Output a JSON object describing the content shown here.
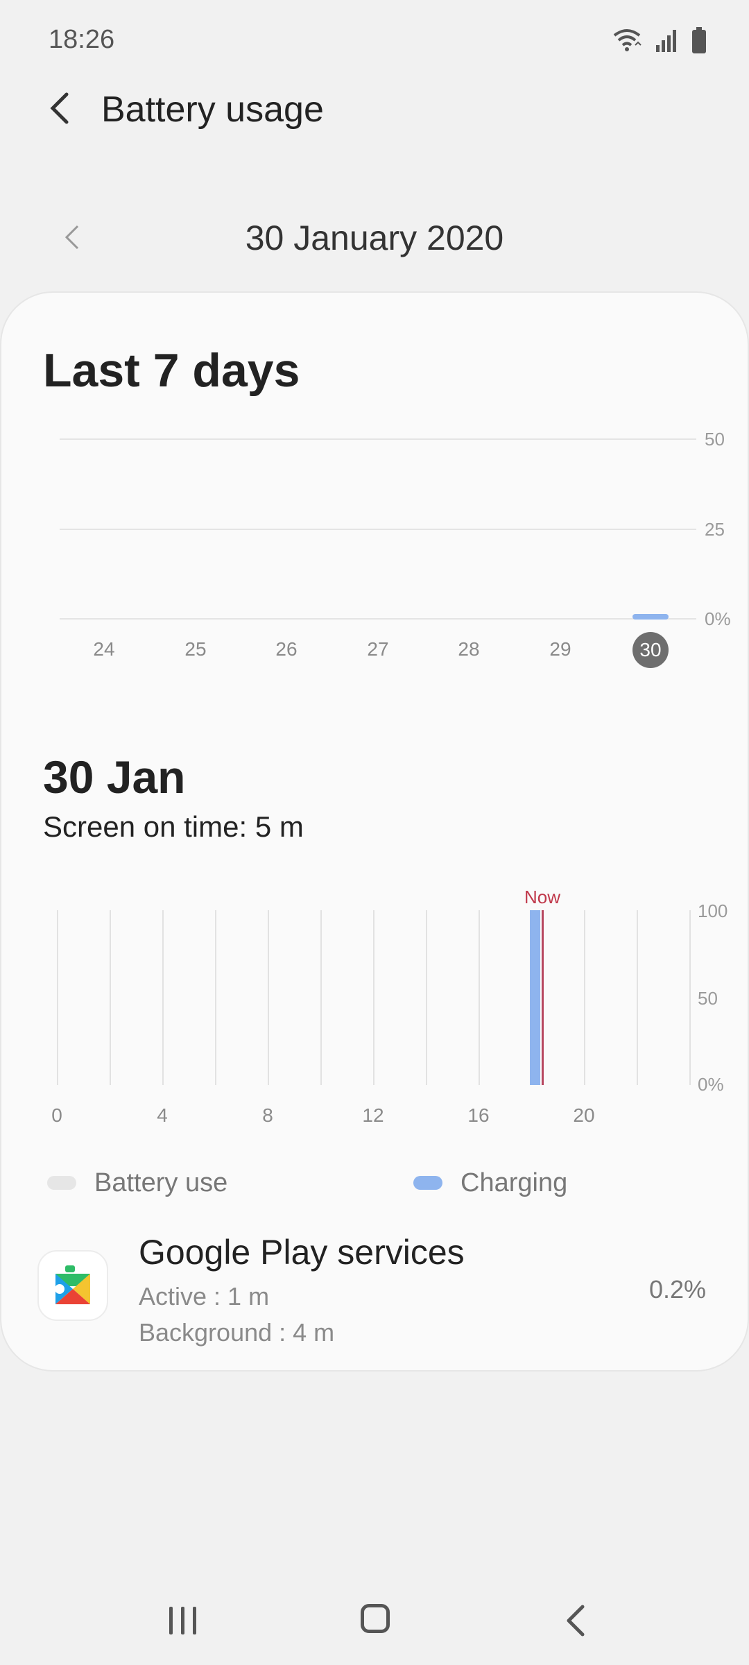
{
  "status_bar": {
    "time": "18:26"
  },
  "header": {
    "title": "Battery usage"
  },
  "date_selector": {
    "label": "30 January 2020"
  },
  "weekly": {
    "title": "Last 7 days",
    "y_labels": [
      "50",
      "25",
      "0%"
    ],
    "days": [
      "24",
      "25",
      "26",
      "27",
      "28",
      "29",
      "30"
    ],
    "selected_day": "30"
  },
  "daily": {
    "title": "30 Jan",
    "screen_on_time": "Screen on time: 5 m",
    "now_label": "Now",
    "y_labels": [
      "100",
      "50",
      "0%"
    ],
    "x_labels": [
      "0",
      "4",
      "8",
      "12",
      "16",
      "20"
    ]
  },
  "legend": {
    "battery_use": "Battery use",
    "charging": "Charging"
  },
  "apps": [
    {
      "name": "Google Play services",
      "active": "Active : 1 m",
      "background": "Background : 4 m",
      "percent": "0.2%"
    }
  ],
  "chart_data": [
    {
      "type": "bar",
      "title": "Last 7 days",
      "categories": [
        "24",
        "25",
        "26",
        "27",
        "28",
        "29",
        "30"
      ],
      "values": [
        0,
        0,
        0,
        0,
        0,
        0,
        1
      ],
      "ylim": [
        0,
        50
      ]
    },
    {
      "type": "area",
      "title": "30 Jan",
      "x_ticks": [
        "0",
        "4",
        "8",
        "12",
        "16",
        "20"
      ],
      "ylim": [
        0,
        100
      ],
      "series": [
        {
          "name": "Charging",
          "x": [
            18.0,
            18.4
          ],
          "values": [
            92,
            100
          ]
        }
      ],
      "now_marker": 18.43
    }
  ],
  "colors": {
    "charging": "#8eb4ee",
    "now": "#c0394b",
    "battery_use": "#e6e6e6"
  }
}
